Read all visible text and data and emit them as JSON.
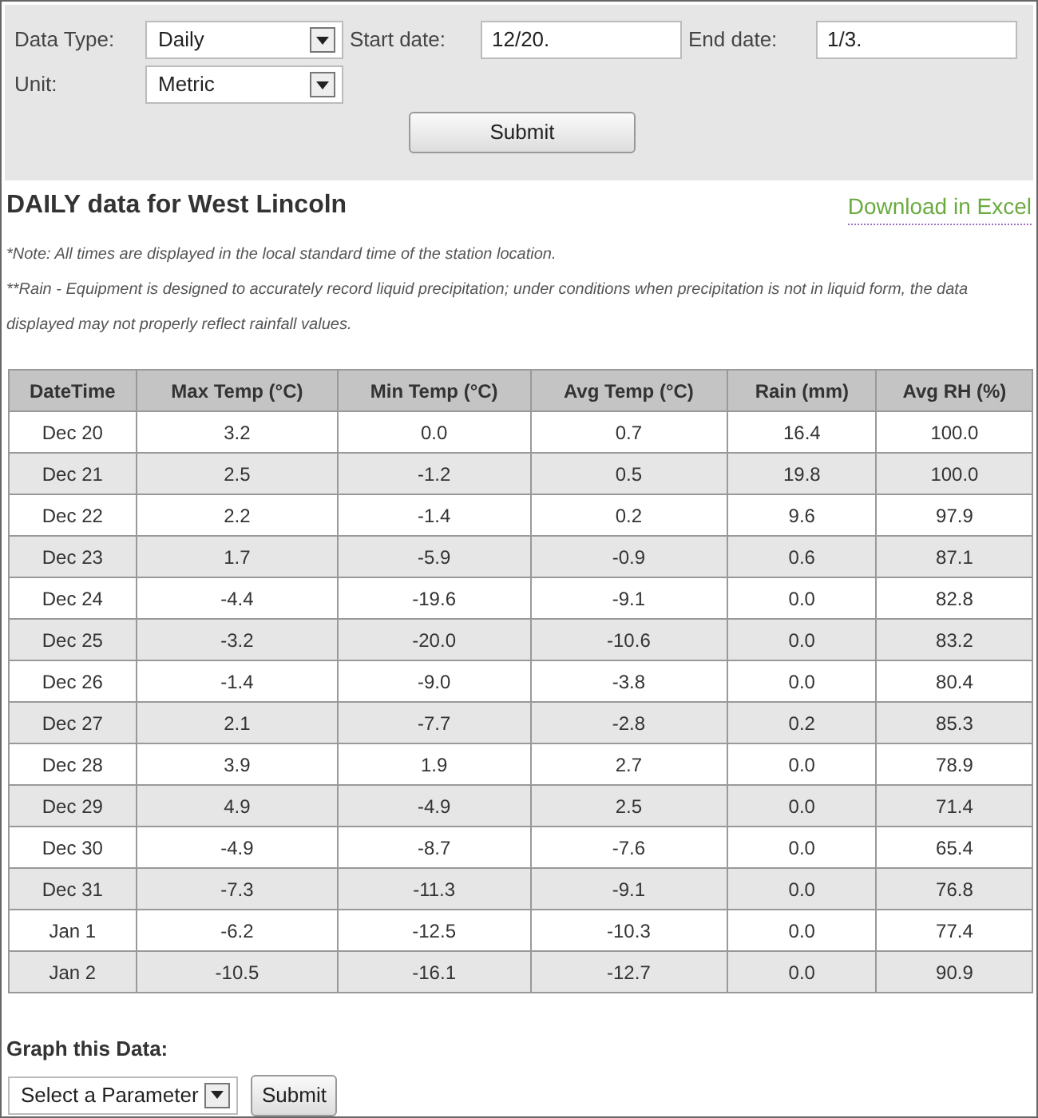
{
  "form": {
    "data_type": {
      "label": "Data Type:",
      "value": "Daily"
    },
    "start_date": {
      "label": "Start date:",
      "value": "12/20."
    },
    "end_date": {
      "label": "End date:",
      "value": "1/3."
    },
    "unit": {
      "label": "Unit:",
      "value": "Metric"
    },
    "submit": "Submit"
  },
  "heading": "DAILY data for West Lincoln",
  "download_link": "Download in Excel",
  "notes": [
    "*Note: All times are displayed in the local standard time of the station location.",
    "**Rain - Equipment is designed to accurately record liquid precipitation; under conditions when precipitation is not in liquid form, the data displayed may not properly reflect rainfall values."
  ],
  "table": {
    "columns": [
      "DateTime",
      "Max Temp (°C)",
      "Min Temp (°C)",
      "Avg Temp (°C)",
      "Rain (mm)",
      "Avg RH (%)"
    ],
    "rows": [
      [
        "Dec 20",
        "3.2",
        "0.0",
        "0.7",
        "16.4",
        "100.0"
      ],
      [
        "Dec 21",
        "2.5",
        "-1.2",
        "0.5",
        "19.8",
        "100.0"
      ],
      [
        "Dec 22",
        "2.2",
        "-1.4",
        "0.2",
        "9.6",
        "97.9"
      ],
      [
        "Dec 23",
        "1.7",
        "-5.9",
        "-0.9",
        "0.6",
        "87.1"
      ],
      [
        "Dec 24",
        "-4.4",
        "-19.6",
        "-9.1",
        "0.0",
        "82.8"
      ],
      [
        "Dec 25",
        "-3.2",
        "-20.0",
        "-10.6",
        "0.0",
        "83.2"
      ],
      [
        "Dec 26",
        "-1.4",
        "-9.0",
        "-3.8",
        "0.0",
        "80.4"
      ],
      [
        "Dec 27",
        "2.1",
        "-7.7",
        "-2.8",
        "0.2",
        "85.3"
      ],
      [
        "Dec 28",
        "3.9",
        "1.9",
        "2.7",
        "0.0",
        "78.9"
      ],
      [
        "Dec 29",
        "4.9",
        "-4.9",
        "2.5",
        "0.0",
        "71.4"
      ],
      [
        "Dec 30",
        "-4.9",
        "-8.7",
        "-7.6",
        "0.0",
        "65.4"
      ],
      [
        "Dec 31",
        "-7.3",
        "-11.3",
        "-9.1",
        "0.0",
        "76.8"
      ],
      [
        "Jan 1",
        "-6.2",
        "-12.5",
        "-10.3",
        "0.0",
        "77.4"
      ],
      [
        "Jan 2",
        "-10.5",
        "-16.1",
        "-12.7",
        "0.0",
        "90.9"
      ]
    ]
  },
  "graph": {
    "label": "Graph this Data:",
    "select": "Select a Parameter",
    "submit": "Submit"
  }
}
